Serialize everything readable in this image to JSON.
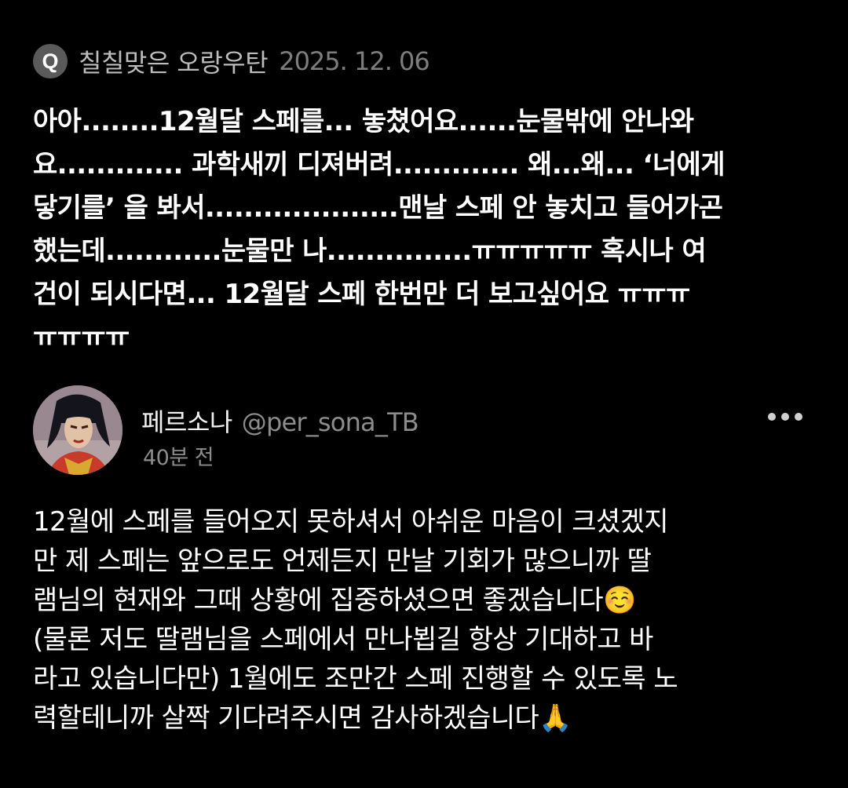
{
  "question": {
    "badge": "Q",
    "author": "칠칠맞은 오랑우탄",
    "date": "2025. 12. 06",
    "text": "아아........12월달 스페를... 놓쳤어요......눈물밖에 안나와\n요............. 과학새끼 디져버려............. 왜...왜... ‘너에게\n닿기를’ 을 봐서....................맨날 스페 안 놓치고 들어가곤\n했는데............눈물만 나...............ㅠㅠㅠㅠㅠ 혹시나 여\n건이 되시다면... 12월달 스페 한번만 더 보고싶어요 ㅠㅠㅠ\nㅠㅠㅠㅠ"
  },
  "answer": {
    "avatar_icon": "profile-avatar",
    "name": "페르소나",
    "handle": "@per_sona_TB",
    "time": "40분 전",
    "more_icon": "more-horizontal-icon",
    "text": "12월에 스페를 들어오지 못하셔서 아쉬운 마음이 크셨겠지\n만 제 스페는 앞으로도 언제든지 만날 기회가 많으니까 딸\n램님의 현재와 그때 상황에 집중하셨으면 좋겠습니다☺️\n(물론 저도 딸램님을 스페에서 만나뵙길 항상 기대하고 바\n라고 있습니다만) 1월에도 조만간 스페 진행할 수 있도록 노\n력할테니까 살짝 기다려주시면 감사하겠습니다🙏"
  },
  "colors": {
    "background": "#000000",
    "text_primary": "#ffffff",
    "text_secondary": "#8c8c8c",
    "badge": "#5a5a5a"
  }
}
